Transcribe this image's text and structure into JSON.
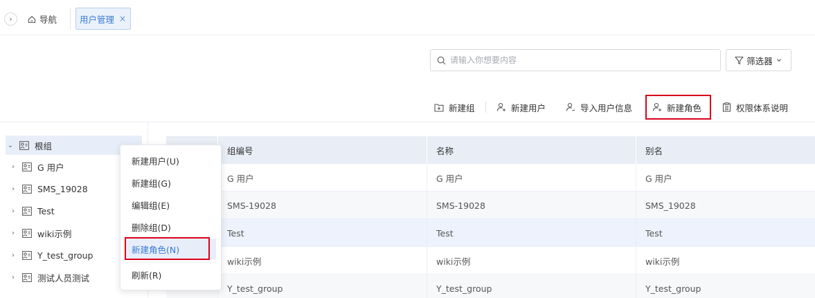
{
  "topbar": {
    "nav_label": "导航",
    "tab_label": "用户管理",
    "tab_close": "×",
    "expand_glyph": "›"
  },
  "search": {
    "placeholder": "请输入你想要内容",
    "value": ""
  },
  "filter": {
    "label": "筛选器"
  },
  "toolbar": {
    "new_group": "新建组",
    "new_user": "新建用户",
    "import_user": "导入用户信息",
    "new_role": "新建角色",
    "permission_doc": "权限体系说明"
  },
  "tree": {
    "root": "根组",
    "items": [
      "G 用户",
      "SMS_19028",
      "Test",
      "wiki示例",
      "Y_test_group",
      "测试人员测试"
    ]
  },
  "table": {
    "headers": [
      "组编号",
      "名称",
      "别名"
    ],
    "rows": [
      [
        "G 用户",
        "G 用户",
        "G 用户"
      ],
      [
        "SMS-19028",
        "SMS-19028",
        "SMS_19028"
      ],
      [
        "Test",
        "Test",
        "Test"
      ],
      [
        "wiki示例",
        "wiki示例",
        "wiki示例"
      ],
      [
        "Y_test_group",
        "Y_test_group",
        "Y_test_group"
      ]
    ]
  },
  "context_menu": {
    "items": [
      "新建用户(U)",
      "新建组(G)",
      "编辑组(E)",
      "删除组(D)",
      "新建角色(N)",
      "刷新(R)"
    ]
  },
  "colors": {
    "accent": "#3a7bd5",
    "highlight_box": "#d9001b",
    "header_bg": "#e9edf5",
    "selected_bg": "#e8eef9"
  }
}
